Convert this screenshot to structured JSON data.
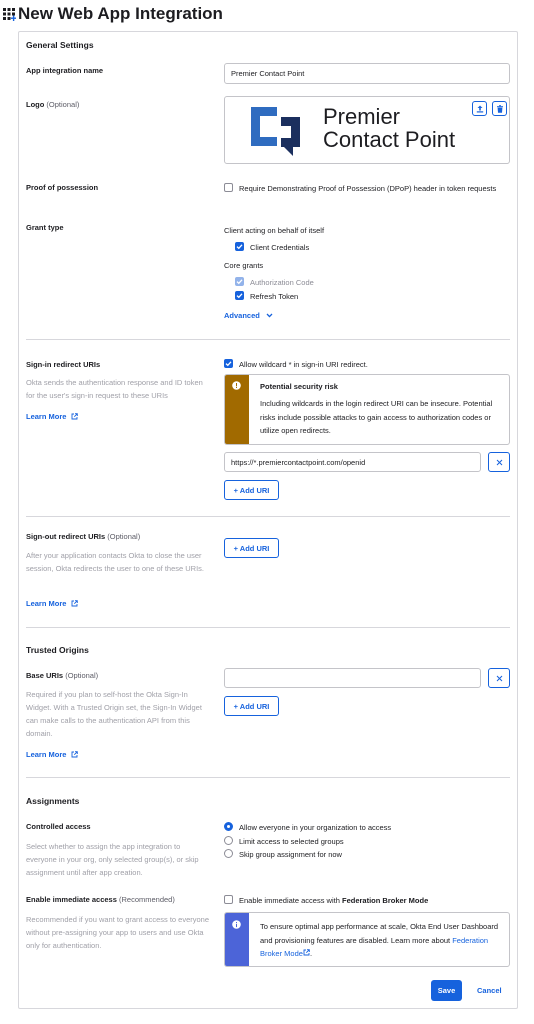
{
  "page": {
    "title": "New Web App Integration"
  },
  "general": {
    "heading": "General Settings",
    "app_name_label": "App integration name",
    "app_name_value": "Premier Contact Point",
    "logo_label": "Logo",
    "logo_optional": "(Optional)",
    "logo_text_line1": "Premier",
    "logo_text_line2": "Contact Point",
    "pop_label": "Proof of possession",
    "pop_checkbox_text": "Require Demonstrating Proof of Possession (DPoP) header in token requests",
    "grant_label": "Grant type",
    "grant_group1": "Client acting on behalf of itself",
    "grant_client_credentials": "Client Credentials",
    "grant_group2": "Core grants",
    "grant_auth_code": "Authorization Code",
    "grant_refresh_token": "Refresh Token",
    "advanced_label": "Advanced"
  },
  "signin": {
    "label": "Sign-in redirect URIs",
    "help": "Okta sends the authentication response and ID token for the user's sign-in request to these URIs",
    "learn_more": "Learn More",
    "wildcard_text": "Allow wildcard * in sign-in URI redirect.",
    "warn_title": "Potential security risk",
    "warn_body": "Including wildcards in the login redirect URI can be insecure. Potential risks include possible attacks to gain access to authorization codes or utilize open redirects.",
    "uri_value": "https://*.premiercontactpoint.com/openid",
    "add_uri": "+ Add URI"
  },
  "signout": {
    "label": "Sign-out redirect URIs",
    "optional": "(Optional)",
    "help": "After your application contacts Okta to close the user session, Okta redirects the user to one of these URIs.",
    "learn_more": "Learn More",
    "add_uri": "+ Add URI"
  },
  "trusted": {
    "heading": "Trusted Origins",
    "label": "Base URIs",
    "optional": "(Optional)",
    "help": "Required if you plan to self-host the Okta Sign-In Widget. With a Trusted Origin set, the Sign-In Widget can make calls to the authentication API from this domain.",
    "learn_more": "Learn More",
    "add_uri": "+ Add URI"
  },
  "assignments": {
    "heading": "Assignments",
    "controlled_label": "Controlled access",
    "controlled_help": "Select whether to assign the app integration to everyone in your org, only selected group(s), or skip assignment until after app creation.",
    "opt1": "Allow everyone in your organization to access",
    "opt2": "Limit access to selected groups",
    "opt3": "Skip group assignment for now",
    "immediate_label": "Enable immediate access",
    "immediate_rec": "(Recommended)",
    "immediate_help": "Recommended if you want to grant access to everyone without pre-assigning your app to users and use Okta only for authentication.",
    "immediate_cb_text": "Enable immediate access with",
    "immediate_cb_bold": "Federation Broker Mode",
    "info_text": "To ensure optimal app performance at scale, Okta End User Dashboard and provisioning features are disabled. Learn more about",
    "info_link": "Federation Broker Mode",
    "info_end": "."
  },
  "footer": {
    "save": "Save",
    "cancel": "Cancel"
  },
  "colors": {
    "accent": "#1662dd",
    "warning": "#a16a00",
    "info": "#4c64d8",
    "logo_blue": "#2f6cc0",
    "logo_navy": "#1b2f5e"
  },
  "icons": [
    "grid-plus-icon",
    "upload-icon",
    "trash-icon",
    "external-link-icon",
    "chevron-down-icon",
    "warning-icon",
    "info-icon",
    "close-icon",
    "check-icon"
  ]
}
